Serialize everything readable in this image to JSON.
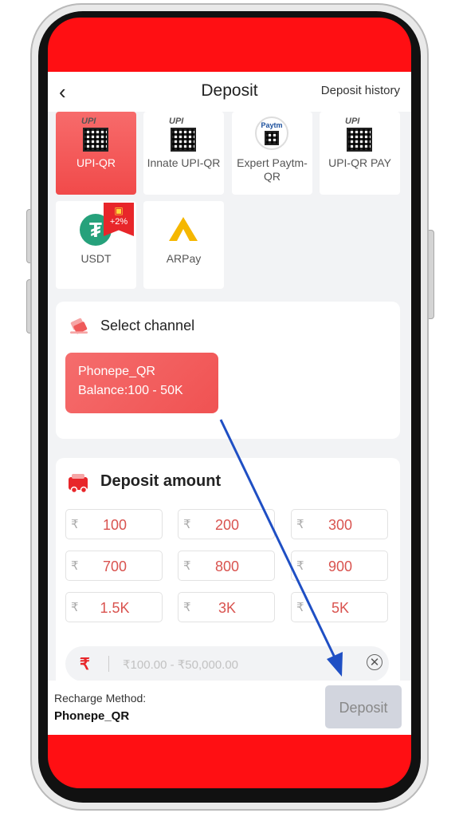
{
  "header": {
    "title": "Deposit",
    "history_link": "Deposit history"
  },
  "methods": [
    {
      "label": "UPI-QR",
      "badge": "UPI"
    },
    {
      "label": "Innate UPI-QR",
      "badge": "UPI"
    },
    {
      "label": "Expert Paytm-QR",
      "badge": "Paytm"
    },
    {
      "label": "UPI-QR PAY",
      "badge": "UPI"
    },
    {
      "label": "USDT",
      "bonus": "+2%"
    },
    {
      "label": "ARPay"
    }
  ],
  "channel": {
    "title": "Select channel",
    "option": {
      "name": "Phonepe_QR",
      "balance": "Balance:100 - 50K"
    }
  },
  "amount": {
    "title": "Deposit amount",
    "currency": "₹",
    "presets": [
      "100",
      "200",
      "300",
      "700",
      "800",
      "900",
      "1.5K",
      "3K",
      "5K"
    ],
    "input_placeholder": "₹100.00 - ₹50,000.00"
  },
  "footer": {
    "method_label": "Recharge Method:",
    "method_value": "Phonepe_QR",
    "deposit_button": "Deposit"
  },
  "colors": {
    "accent": "#f14a4a",
    "frame_red": "#ff0f13",
    "arrow": "#1f4fc4"
  }
}
